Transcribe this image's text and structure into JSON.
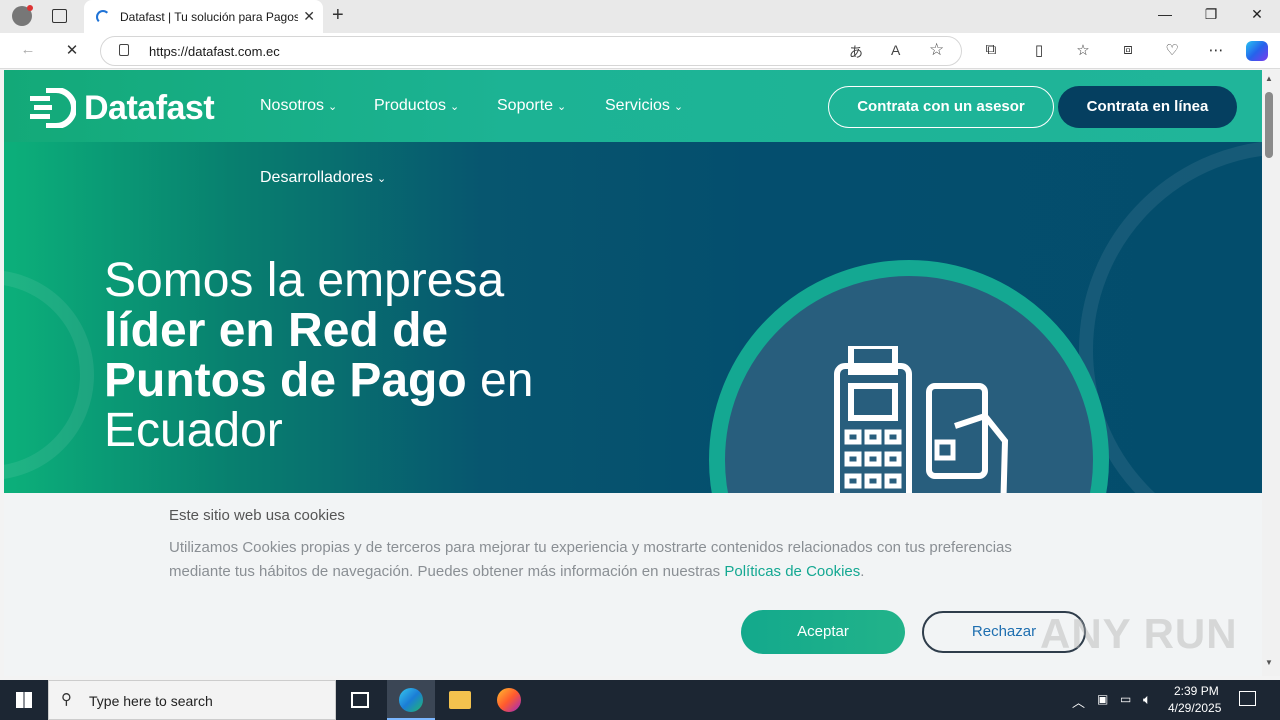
{
  "browser": {
    "tab_title": "Datafast | Tu solución para Pagos",
    "url": "https://datafast.com.ec"
  },
  "site": {
    "logo_text": "Datafast",
    "nav": [
      {
        "label": "Nosotros"
      },
      {
        "label": "Productos"
      },
      {
        "label": "Soporte"
      },
      {
        "label": "Servicios"
      },
      {
        "label": "Desarrolladores"
      }
    ],
    "cta_asesor": "Contrata con un asesor",
    "cta_linea": "Contrata en línea",
    "headline": {
      "l1": "Somos la empresa",
      "l2": "líder en Red de",
      "l3b": "Puntos de Pago",
      "l3": " en",
      "l4": "Ecuador"
    }
  },
  "cookie": {
    "title": "Este sitio web usa cookies",
    "text": "Utilizamos Cookies propias y de terceros para mejorar tu experiencia y mostrarte contenidos relacionados con tus preferencias mediante tus hábitos de navegación. Puedes obtener más información en nuestras ",
    "link": "Políticas de Cookies",
    "end": ".",
    "accept": "Aceptar",
    "reject": "Rechazar"
  },
  "taskbar": {
    "search_placeholder": "Type here to search",
    "time": "2:39 PM",
    "date": "4/29/2025"
  },
  "watermark": "ANY RUN",
  "colors": {
    "brand_green": "#1cb394",
    "brand_navy": "#053f60",
    "link": "#14a892"
  }
}
